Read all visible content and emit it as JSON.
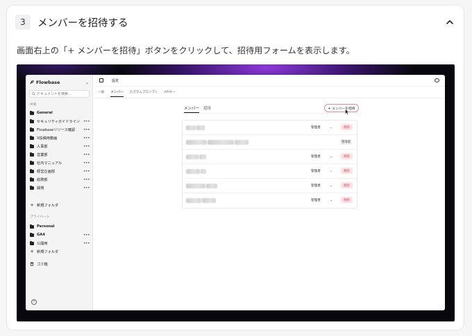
{
  "step": {
    "number": "3",
    "title": "メンバーを招待する",
    "description": "画面右上の「+ メンバーを招待」ボタンをクリックして、招待用フォームを表示します。"
  },
  "app": {
    "brand": "Flowbase",
    "search_placeholder": "ドキュメントを検索...",
    "shared_label": "共有",
    "shared_items": [
      {
        "label": "General",
        "bold": true
      },
      {
        "label": "セキュリティガイドライン"
      },
      {
        "label": "Flowbaseリリース確認"
      },
      {
        "label": "X投稿用動画"
      },
      {
        "label": "人事部"
      },
      {
        "label": "営業部"
      },
      {
        "label": "社内マニュアル"
      },
      {
        "label": "経営企画部"
      },
      {
        "label": "総務部"
      },
      {
        "label": "開発"
      }
    ],
    "new_folder": "新規フォルダ",
    "private_label": "プライベート",
    "private_items": [
      {
        "label": "Personal",
        "bold": true
      },
      {
        "label": "GA4",
        "bold": true
      },
      {
        "label": "公開用"
      }
    ],
    "trash": "ゴミ箱",
    "help": "?",
    "header_title": "設定",
    "tabs": [
      "一般",
      "メンバー",
      "カスタムプロンプト",
      "APIキー"
    ],
    "subtabs": [
      "メンバー",
      "招待"
    ],
    "add_member_button": "+ メンバーを招待",
    "members": [
      {
        "role": "管理者",
        "action": "削除",
        "type": "select"
      },
      {
        "role": "管理者",
        "action": "",
        "type": "plain"
      },
      {
        "role": "管理者",
        "action": "削除",
        "type": "select"
      },
      {
        "role": "管理者",
        "action": "削除",
        "type": "select"
      },
      {
        "role": "管理者",
        "action": "削除",
        "type": "select"
      },
      {
        "role": "管理者",
        "action": "削除",
        "type": "select"
      }
    ]
  }
}
